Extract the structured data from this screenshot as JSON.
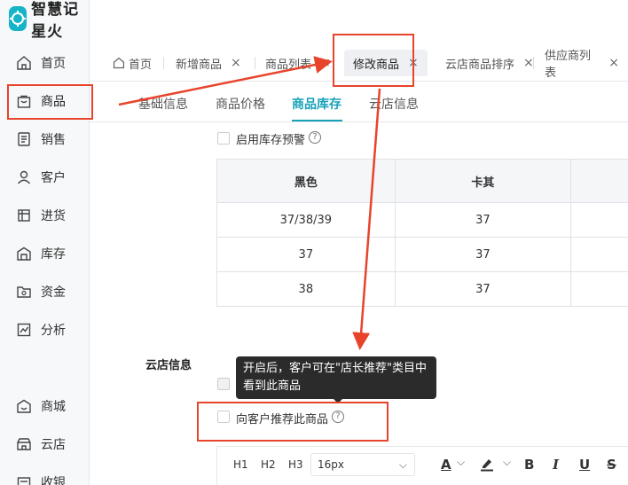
{
  "app": {
    "brand": "智慧记星火"
  },
  "sidebar": {
    "items": [
      {
        "label": "首页",
        "icon": "home-icon"
      },
      {
        "label": "商品",
        "icon": "bag-icon",
        "active": true
      },
      {
        "label": "销售",
        "icon": "sales-icon"
      },
      {
        "label": "客户",
        "icon": "user-icon"
      },
      {
        "label": "进货",
        "icon": "purchase-icon"
      },
      {
        "label": "库存",
        "icon": "warehouse-icon"
      },
      {
        "label": "资金",
        "icon": "folder-icon"
      },
      {
        "label": "分析",
        "icon": "chart-icon"
      },
      {
        "label": "商城",
        "icon": "shop-icon"
      },
      {
        "label": "云店",
        "icon": "cloud-store-icon"
      },
      {
        "label": "收银",
        "icon": "cashier-icon"
      }
    ]
  },
  "tabs": [
    {
      "label": "首页",
      "closable": false
    },
    {
      "label": "新增商品",
      "closable": true
    },
    {
      "label": "商品列表",
      "closable": true
    },
    {
      "label": "修改商品",
      "closable": true,
      "active": true
    },
    {
      "label": "云店商品排序",
      "closable": true
    },
    {
      "label": "供应商列表",
      "closable": true
    }
  ],
  "tab_close_glyph": "×",
  "subtabs": [
    {
      "label": "基础信息"
    },
    {
      "label": "商品价格"
    },
    {
      "label": "商品库存",
      "active": true
    },
    {
      "label": "云店信息"
    }
  ],
  "stock_warning": {
    "label": "启用库存预警",
    "checked": false
  },
  "help_glyph": "?",
  "stock_table": {
    "headers": [
      "黑色",
      "卡其",
      ""
    ],
    "rows": [
      [
        "37/38/39",
        "37",
        ""
      ],
      [
        "37",
        "37",
        ""
      ],
      [
        "38",
        "37",
        ""
      ]
    ]
  },
  "cloud_section": {
    "title": "云店信息",
    "tooltip": "开启后，客户可在\"店长推荐\"类目中看到此商品",
    "recommend": {
      "label": "向客户推荐此商品",
      "checked": false
    }
  },
  "editor_toolbar": {
    "headings": [
      "H1",
      "H2",
      "H3"
    ],
    "font_size": "16px",
    "font_color_glyph": "A",
    "bold_glyph": "B",
    "italic_glyph": "I",
    "underline_glyph": "U",
    "strike_glyph": "S",
    "chevron_glyph": "⌵"
  },
  "colors": {
    "accent": "#17a2b8",
    "annotation": "#e8442c",
    "tooltip_bg": "#2b2b2b"
  }
}
